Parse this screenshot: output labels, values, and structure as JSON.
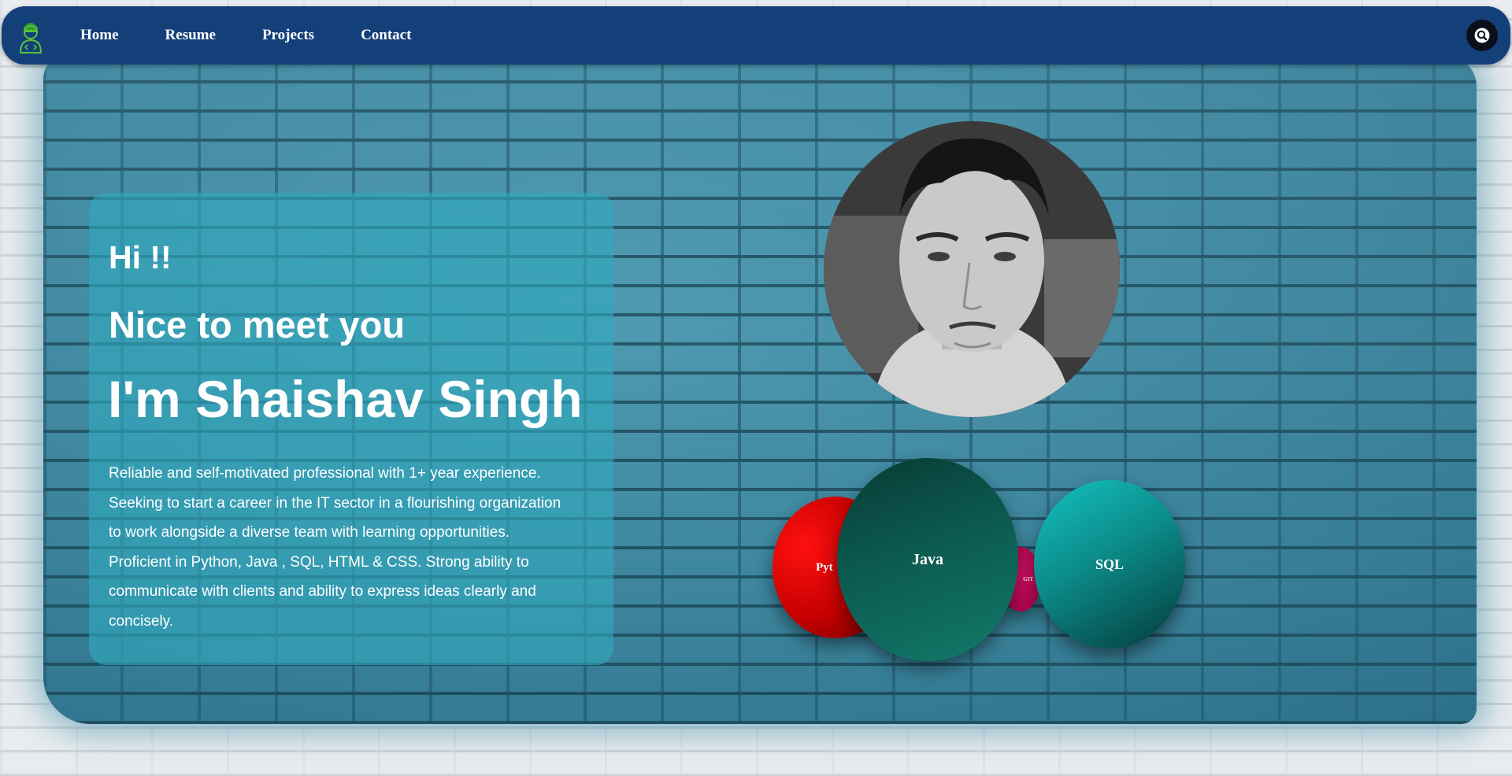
{
  "nav": {
    "items": [
      "Home",
      "Resume",
      "Projects",
      "Contact"
    ]
  },
  "intro": {
    "greeting": "Hi !!",
    "nice_to_meet": "Nice to meet you",
    "name_line": "I'm Shaishav Singh",
    "bio_lines": [
      "Reliable and self-motivated professional with 1+ year experience.",
      "Seeking to start a career in the IT sector in a flourishing organization",
      "to work alongside a diverse team with learning opportunities.",
      "Proficient in Python, Java , SQL, HTML & CSS. Strong ability to",
      "communicate with clients and ability to express ideas clearly and",
      "concisely."
    ]
  },
  "skills": {
    "python": "Pyt",
    "java": "Java",
    "git": "GIT",
    "sql": "SQL"
  },
  "colors": {
    "navbar": "#14407a",
    "card": "#30aabe",
    "python": "#c40000",
    "java": "#0c5a50",
    "git": "#a10046",
    "sql": "#0b8b89"
  },
  "icons": {
    "logo": "developer-avatar-icon",
    "search": "search-icon"
  }
}
